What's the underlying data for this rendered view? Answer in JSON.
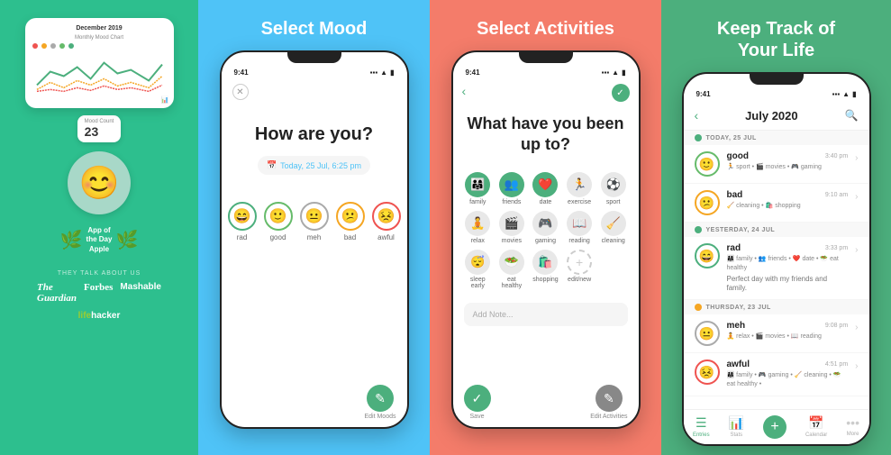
{
  "panel1": {
    "chart_title": "Monthly Mood Chart",
    "chart_subtitle": "December 2019",
    "mood_count_label": "Mood Count",
    "mood_count_number": "23",
    "app_of_day_line1": "App of",
    "app_of_day_line2": "the Day",
    "app_of_day_brand": "Apple",
    "talk_about_us": "THEY TALK ABOUT US",
    "press": [
      "The Guardian",
      "Forbes",
      "Mashable",
      "lifehacker"
    ]
  },
  "panel2": {
    "title": "Select Mood",
    "status_time": "9:41",
    "question": "How are you?",
    "date_text": "Today, 25 Jul, 6:25 pm",
    "moods": [
      {
        "emoji": "😄",
        "label": "rad"
      },
      {
        "emoji": "🙂",
        "label": "good"
      },
      {
        "emoji": "😐",
        "label": "meh"
      },
      {
        "emoji": "😕",
        "label": "bad"
      },
      {
        "emoji": "😣",
        "label": "awful"
      }
    ],
    "edit_moods_label": "Edit Moods"
  },
  "panel3": {
    "title": "Select Activities",
    "status_time": "9:41",
    "question": "What have you been up to?",
    "activities": [
      {
        "icon": "👨‍👩‍👧",
        "label": "family",
        "active": true
      },
      {
        "icon": "👥",
        "label": "friends",
        "active": true
      },
      {
        "icon": "❤️",
        "label": "date",
        "active": true
      },
      {
        "icon": "🏃",
        "label": "exercise",
        "active": false
      },
      {
        "icon": "⚽",
        "label": "sport",
        "active": false
      },
      {
        "icon": "🧘",
        "label": "relax",
        "active": false
      },
      {
        "icon": "🎬",
        "label": "movies",
        "active": false
      },
      {
        "icon": "🎮",
        "label": "gaming",
        "active": false
      },
      {
        "icon": "📖",
        "label": "reading",
        "active": false
      },
      {
        "icon": "🧹",
        "label": "cleaning",
        "active": false
      },
      {
        "icon": "😴",
        "label": "sleep early",
        "active": false
      },
      {
        "icon": "🥗",
        "label": "eat healthy",
        "active": false
      },
      {
        "icon": "🛍️",
        "label": "shopping",
        "active": false
      },
      {
        "icon": "+",
        "label": "edit/new",
        "active": false
      }
    ],
    "add_note_placeholder": "Add Note...",
    "save_label": "Save",
    "edit_activities_label": "Edit Activities"
  },
  "panel4": {
    "title": "Keep Track of\nYour Life",
    "status_time": "9:41",
    "month": "July 2020",
    "entries": [
      {
        "day_header": "TODAY, 25 JUL",
        "mood": "good",
        "time": "3:40 pm",
        "emoji": "🙂",
        "tags": "🏃 sport • 🎬 movies • 🎮 gaming"
      },
      {
        "mood": "bad",
        "time": "9:10 am",
        "emoji": "😕",
        "tags": "🧹 cleaning • 🛍️ shopping"
      },
      {
        "day_header": "YESTERDAY, 24 JUL",
        "mood": "rad",
        "time": "3:33 pm",
        "emoji": "😄",
        "tags": "👨‍👩‍👧 family • 👥 friends • ❤️ date •",
        "note": "🥗 eat healthy",
        "extra_note": "Perfect day with my friends and family."
      },
      {
        "day_header": "THURSDAY, 23 JUL",
        "mood": "meh",
        "time": "9:08 pm",
        "emoji": "😐",
        "tags": "🧘 relax • 🎬 movies • 📖 reading"
      },
      {
        "mood": "awful",
        "time": "4:51 pm",
        "emoji": "😣",
        "tags": "👨‍👩‍👧 family • 🎮 gaming •",
        "note": "🧹 cleaning • 🥗 eat healthy •"
      }
    ],
    "nav_items": [
      "Entries",
      "Stats",
      "+",
      "Calendar",
      "More"
    ]
  }
}
